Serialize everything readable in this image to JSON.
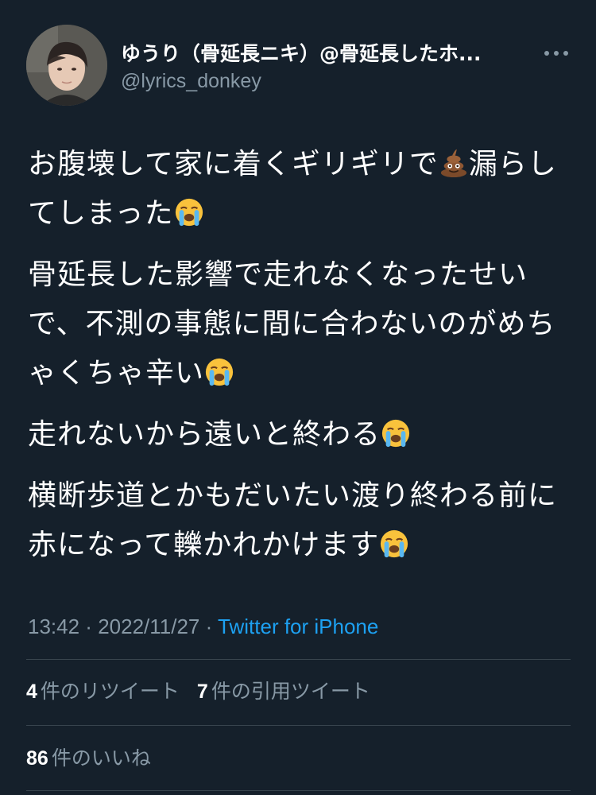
{
  "author": {
    "display_name": "ゆうり（骨延長ニキ）@骨延長したホ...",
    "handle": "@lyrics_donkey"
  },
  "icons": {
    "more": "more-horizontal-icon",
    "poop": "pile-of-poo-emoji",
    "crying": "loudly-crying-face-emoji"
  },
  "tweet": {
    "paragraphs": [
      {
        "before": "お腹壊して家に着くギリギリで",
        "mid": "漏らしてしまった",
        "end": ""
      },
      {
        "text": "骨延長した影響で走れなくなったせいで、不測の事態に間に合わないのがめちゃくちゃ辛い"
      },
      {
        "text": "走れないから遠いと終わる"
      },
      {
        "text": "横断歩道とかもだいたい渡り終わる前に赤になって轢かれかけます"
      }
    ]
  },
  "meta": {
    "time": "13:42",
    "separator": " · ",
    "date": "2022/11/27",
    "source": "Twitter for iPhone"
  },
  "stats": {
    "retweets": {
      "count": "4",
      "label": "件のリツイート"
    },
    "quotes": {
      "count": "7",
      "label": "件の引用ツイート"
    },
    "likes": {
      "count": "86",
      "label": "件のいいね"
    }
  },
  "colors": {
    "background": "#15202b",
    "muted": "#8899a6",
    "link": "#1da1f2",
    "divider": "#38444d"
  }
}
